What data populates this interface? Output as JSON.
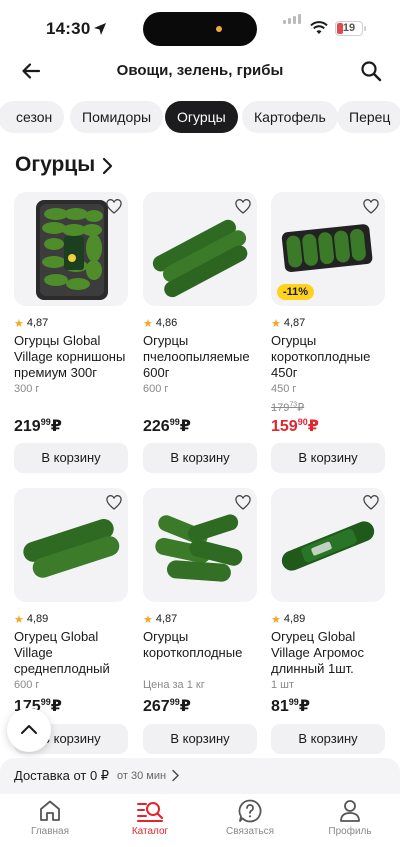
{
  "status": {
    "time": "14:30",
    "battery": "19"
  },
  "header": {
    "title": "Овощи, зелень, грибы"
  },
  "chips": [
    "сезон",
    "Помидоры",
    "Огурцы",
    "Картофель",
    "Перец"
  ],
  "section_title": "Огурцы",
  "cart_label": "В корзину",
  "products": [
    {
      "rating": "4,87",
      "name": "Огурцы Global Village корнишоны премиум 300г",
      "weight": "300 г",
      "price_main": "219",
      "price_kop": "99",
      "currency": "₽"
    },
    {
      "rating": "4,86",
      "name": "Огурцы пчелоопыляемые 600г",
      "weight": "600 г",
      "price_main": "226",
      "price_kop": "99",
      "currency": "₽"
    },
    {
      "rating": "4,87",
      "name": "Огурцы короткоплодные 450г",
      "weight": "450 г",
      "badge": "-11%",
      "old_price_main": "179",
      "old_price_kop": "73",
      "price_main": "159",
      "price_kop": "90",
      "currency": "₽",
      "sale": true
    },
    {
      "rating": "4,89",
      "name": "Огурец Global Village среднеплодный г…",
      "weight": "600 г",
      "price_main": "175",
      "price_kop": "99",
      "currency": "₽"
    },
    {
      "rating": "4,87",
      "name": "Огурцы короткоплодные",
      "weight": "Цена за 1 кг",
      "price_main": "267",
      "price_kop": "99",
      "currency": "₽"
    },
    {
      "rating": "4,89",
      "name": "Огурец Global Village Агромос длинный 1шт.",
      "weight": "1 шт",
      "price_main": "81",
      "price_kop": "99",
      "currency": "₽"
    }
  ],
  "delivery": {
    "main": "Доставка от 0 ₽",
    "sub": "от 30 мин"
  },
  "tabs": [
    {
      "label": "Главная",
      "icon": "home-icon"
    },
    {
      "label": "Каталог",
      "icon": "catalog-search-icon",
      "active": true
    },
    {
      "label": "Связаться",
      "icon": "help-chat-icon"
    },
    {
      "label": "Профиль",
      "icon": "profile-icon"
    }
  ]
}
